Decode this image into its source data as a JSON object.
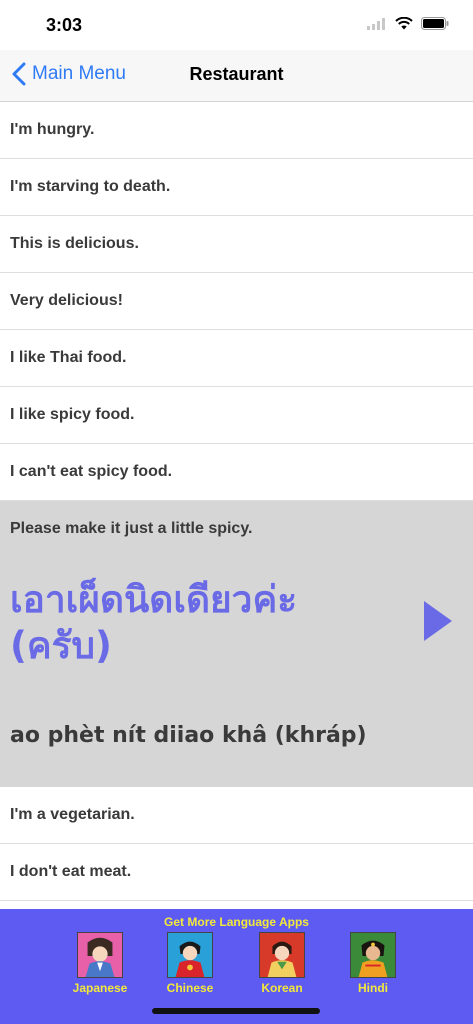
{
  "status": {
    "time": "3:03"
  },
  "nav": {
    "back_label": "Main Menu",
    "title": "Restaurant"
  },
  "phrases": [
    {
      "english": "I'm hungry."
    },
    {
      "english": "I'm starving to death."
    },
    {
      "english": "This is delicious."
    },
    {
      "english": "Very delicious!"
    },
    {
      "english": "I like Thai food."
    },
    {
      "english": "I like spicy food."
    },
    {
      "english": "I can't eat spicy food."
    },
    {
      "english": "Please make it just a little spicy.",
      "thai": "เอาเผ็ดนิดเดียวค่ะ (ครับ)",
      "romanization": "ao phèt nít diiao khâ (khráp)",
      "expanded": true
    },
    {
      "english": "I'm a vegetarian."
    },
    {
      "english": "I don't eat meat."
    }
  ],
  "ad": {
    "title": "Get More Language Apps",
    "apps": [
      {
        "label": "Japanese",
        "icon": "japanese-app-icon"
      },
      {
        "label": "Chinese",
        "icon": "chinese-app-icon"
      },
      {
        "label": "Korean",
        "icon": "korean-app-icon"
      },
      {
        "label": "Hindi",
        "icon": "hindi-app-icon"
      }
    ]
  },
  "colors": {
    "accent": "#2f7bf6",
    "thai_text": "#6a6ae6",
    "ad_background": "#5d5bf2",
    "ad_text": "#f3e93a",
    "expanded_row": "#d6d6d6"
  }
}
